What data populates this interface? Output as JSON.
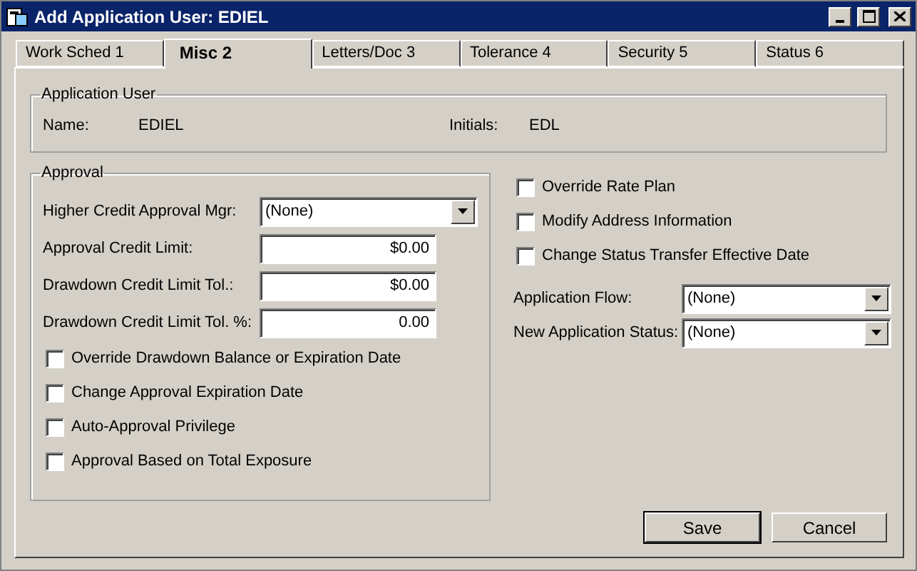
{
  "window": {
    "title": "Add Application User: EDIEL"
  },
  "tabs": [
    {
      "label": "Work Sched 1",
      "selected": false
    },
    {
      "label": "Misc 2",
      "selected": true
    },
    {
      "label": "Letters/Doc 3",
      "selected": false
    },
    {
      "label": "Tolerance 4",
      "selected": false
    },
    {
      "label": "Security 5",
      "selected": false
    },
    {
      "label": "Status 6",
      "selected": false
    }
  ],
  "application_user": {
    "title": "Application User",
    "name_label": "Name:",
    "name": "EDIEL",
    "initials_label": "Initials:",
    "initials": "EDL"
  },
  "approval": {
    "title": "Approval",
    "fields": [
      {
        "kind": "dropdown",
        "label": "Higher Credit Approval Mgr:",
        "value": "(None)"
      },
      {
        "kind": "text",
        "label": "Approval Credit Limit:",
        "value": "$0.00"
      },
      {
        "kind": "text",
        "label": "Drawdown Credit Limit Tol.:",
        "value": "$0.00"
      },
      {
        "kind": "text",
        "label": "Drawdown Credit Limit Tol. %:",
        "value": "0.00"
      }
    ],
    "checkboxes": [
      {
        "label": "Override Drawdown Balance or Expiration Date",
        "checked": false
      },
      {
        "label": "Change Approval Expiration Date",
        "checked": false
      },
      {
        "label": "Auto-Approval Privilege",
        "checked": false
      },
      {
        "label": "Approval Based on Total Exposure",
        "checked": false
      }
    ]
  },
  "right_checkboxes": [
    {
      "label": "Override Rate Plan",
      "checked": false
    },
    {
      "label": "Modify Address Information",
      "checked": false
    },
    {
      "label": "Change Status Transfer Effective Date",
      "checked": false
    }
  ],
  "right_fields": [
    {
      "label": "Application Flow:",
      "value": "(None)"
    },
    {
      "label": "New Application Status:",
      "value": "(None)"
    }
  ],
  "buttons": [
    "Save",
    "Cancel"
  ]
}
